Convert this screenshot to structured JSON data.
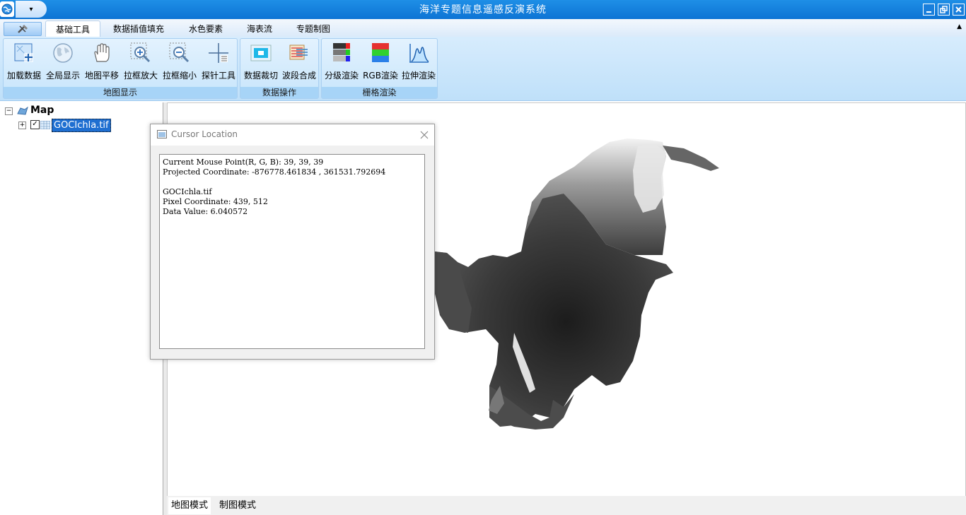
{
  "window": {
    "title": "海洋专题信息遥感反演系统",
    "qat_symbol": "▾"
  },
  "tabs": [
    {
      "label": "基础工具",
      "active": true
    },
    {
      "label": "数据插值填充"
    },
    {
      "label": "水色要素"
    },
    {
      "label": "海表流"
    },
    {
      "label": "专题制图"
    }
  ],
  "ribbon": {
    "groups": [
      {
        "label": "地图显示",
        "buttons": [
          "加载数据",
          "全局显示",
          "地图平移",
          "拉框放大",
          "拉框缩小",
          "探针工具"
        ]
      },
      {
        "label": "数据操作",
        "buttons": [
          "数据裁切",
          "波段合成"
        ]
      },
      {
        "label": "栅格渲染",
        "buttons": [
          "分级渲染",
          "RGB渲染",
          "拉伸渲染"
        ]
      }
    ]
  },
  "tree": {
    "root": "Map",
    "layer": "GOCIchla.tif"
  },
  "dialog": {
    "title": "Cursor Location",
    "lines": [
      "Current Mouse Point(R, G, B): 39, 39, 39",
      "Projected Coordinate: -876778.461834 , 361531.792694",
      "",
      "GOCIchla.tif",
      "Pixel Coordinate: 439, 512",
      "Data Value: 6.040572"
    ]
  },
  "bottom_tabs": [
    "地图模式",
    "制图模式"
  ],
  "colors": {
    "titlebar": "#0d74d4",
    "ribbon": "#c7e5fb",
    "selection": "#1f6fd1"
  }
}
